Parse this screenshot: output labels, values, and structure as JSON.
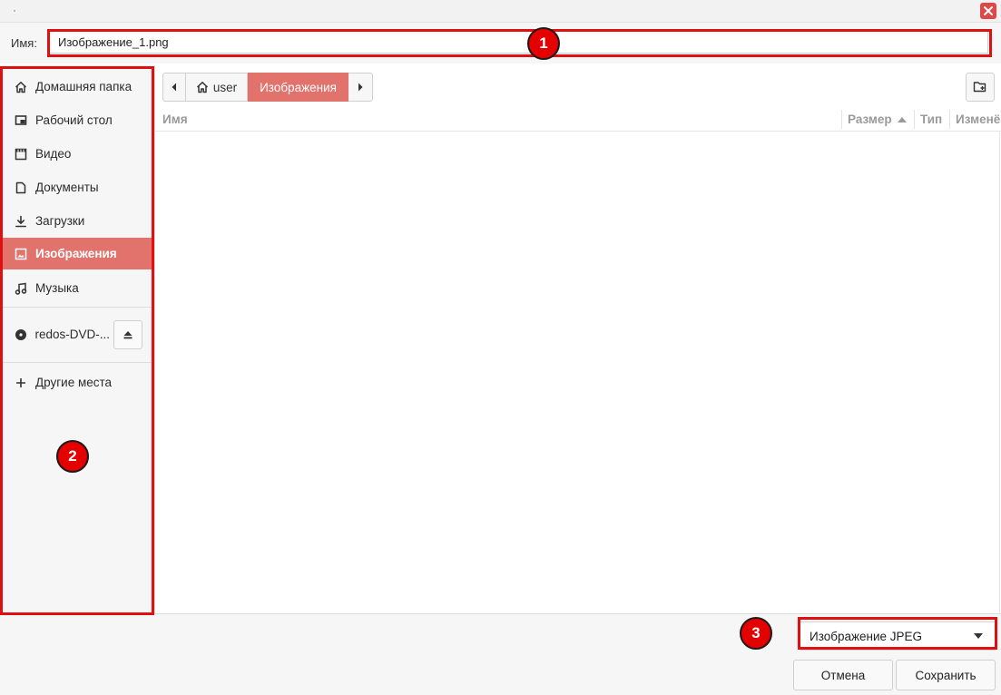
{
  "dialog": {
    "title_mark": "·"
  },
  "name_row": {
    "label": "Имя:",
    "value": "Изображение_1.png"
  },
  "sidebar": {
    "places": [
      {
        "label": "Домашняя папка",
        "icon": "home-icon"
      },
      {
        "label": "Рабочий стол",
        "icon": "desktop-icon"
      },
      {
        "label": "Видео",
        "icon": "video-icon"
      },
      {
        "label": "Документы",
        "icon": "document-icon"
      },
      {
        "label": "Загрузки",
        "icon": "download-icon"
      },
      {
        "label": "Изображения",
        "icon": "image-icon",
        "active": true
      },
      {
        "label": "Музыка",
        "icon": "music-icon"
      }
    ],
    "devices": [
      {
        "label": "redos-DVD-...",
        "icon": "disc-icon"
      }
    ],
    "other": {
      "label": "Другие места",
      "icon": "plus-icon"
    }
  },
  "pathbar": {
    "segments": [
      {
        "label": "user"
      },
      {
        "label": "Изображения",
        "active": true
      }
    ]
  },
  "file_table": {
    "columns": [
      {
        "label": "Имя"
      },
      {
        "label": "Размер",
        "sorted": "ascending"
      },
      {
        "label": "Тип"
      },
      {
        "label": "Изменён"
      }
    ],
    "rows": []
  },
  "filter": {
    "selected": "Изображение JPEG"
  },
  "buttons": {
    "cancel": "Отмена",
    "save": "Сохранить"
  },
  "annotations": [
    "1",
    "2",
    "3"
  ],
  "colors": {
    "accent": "#e1726c",
    "highlight": "#e01010",
    "badge": "#e50000",
    "close": "#e04848"
  }
}
